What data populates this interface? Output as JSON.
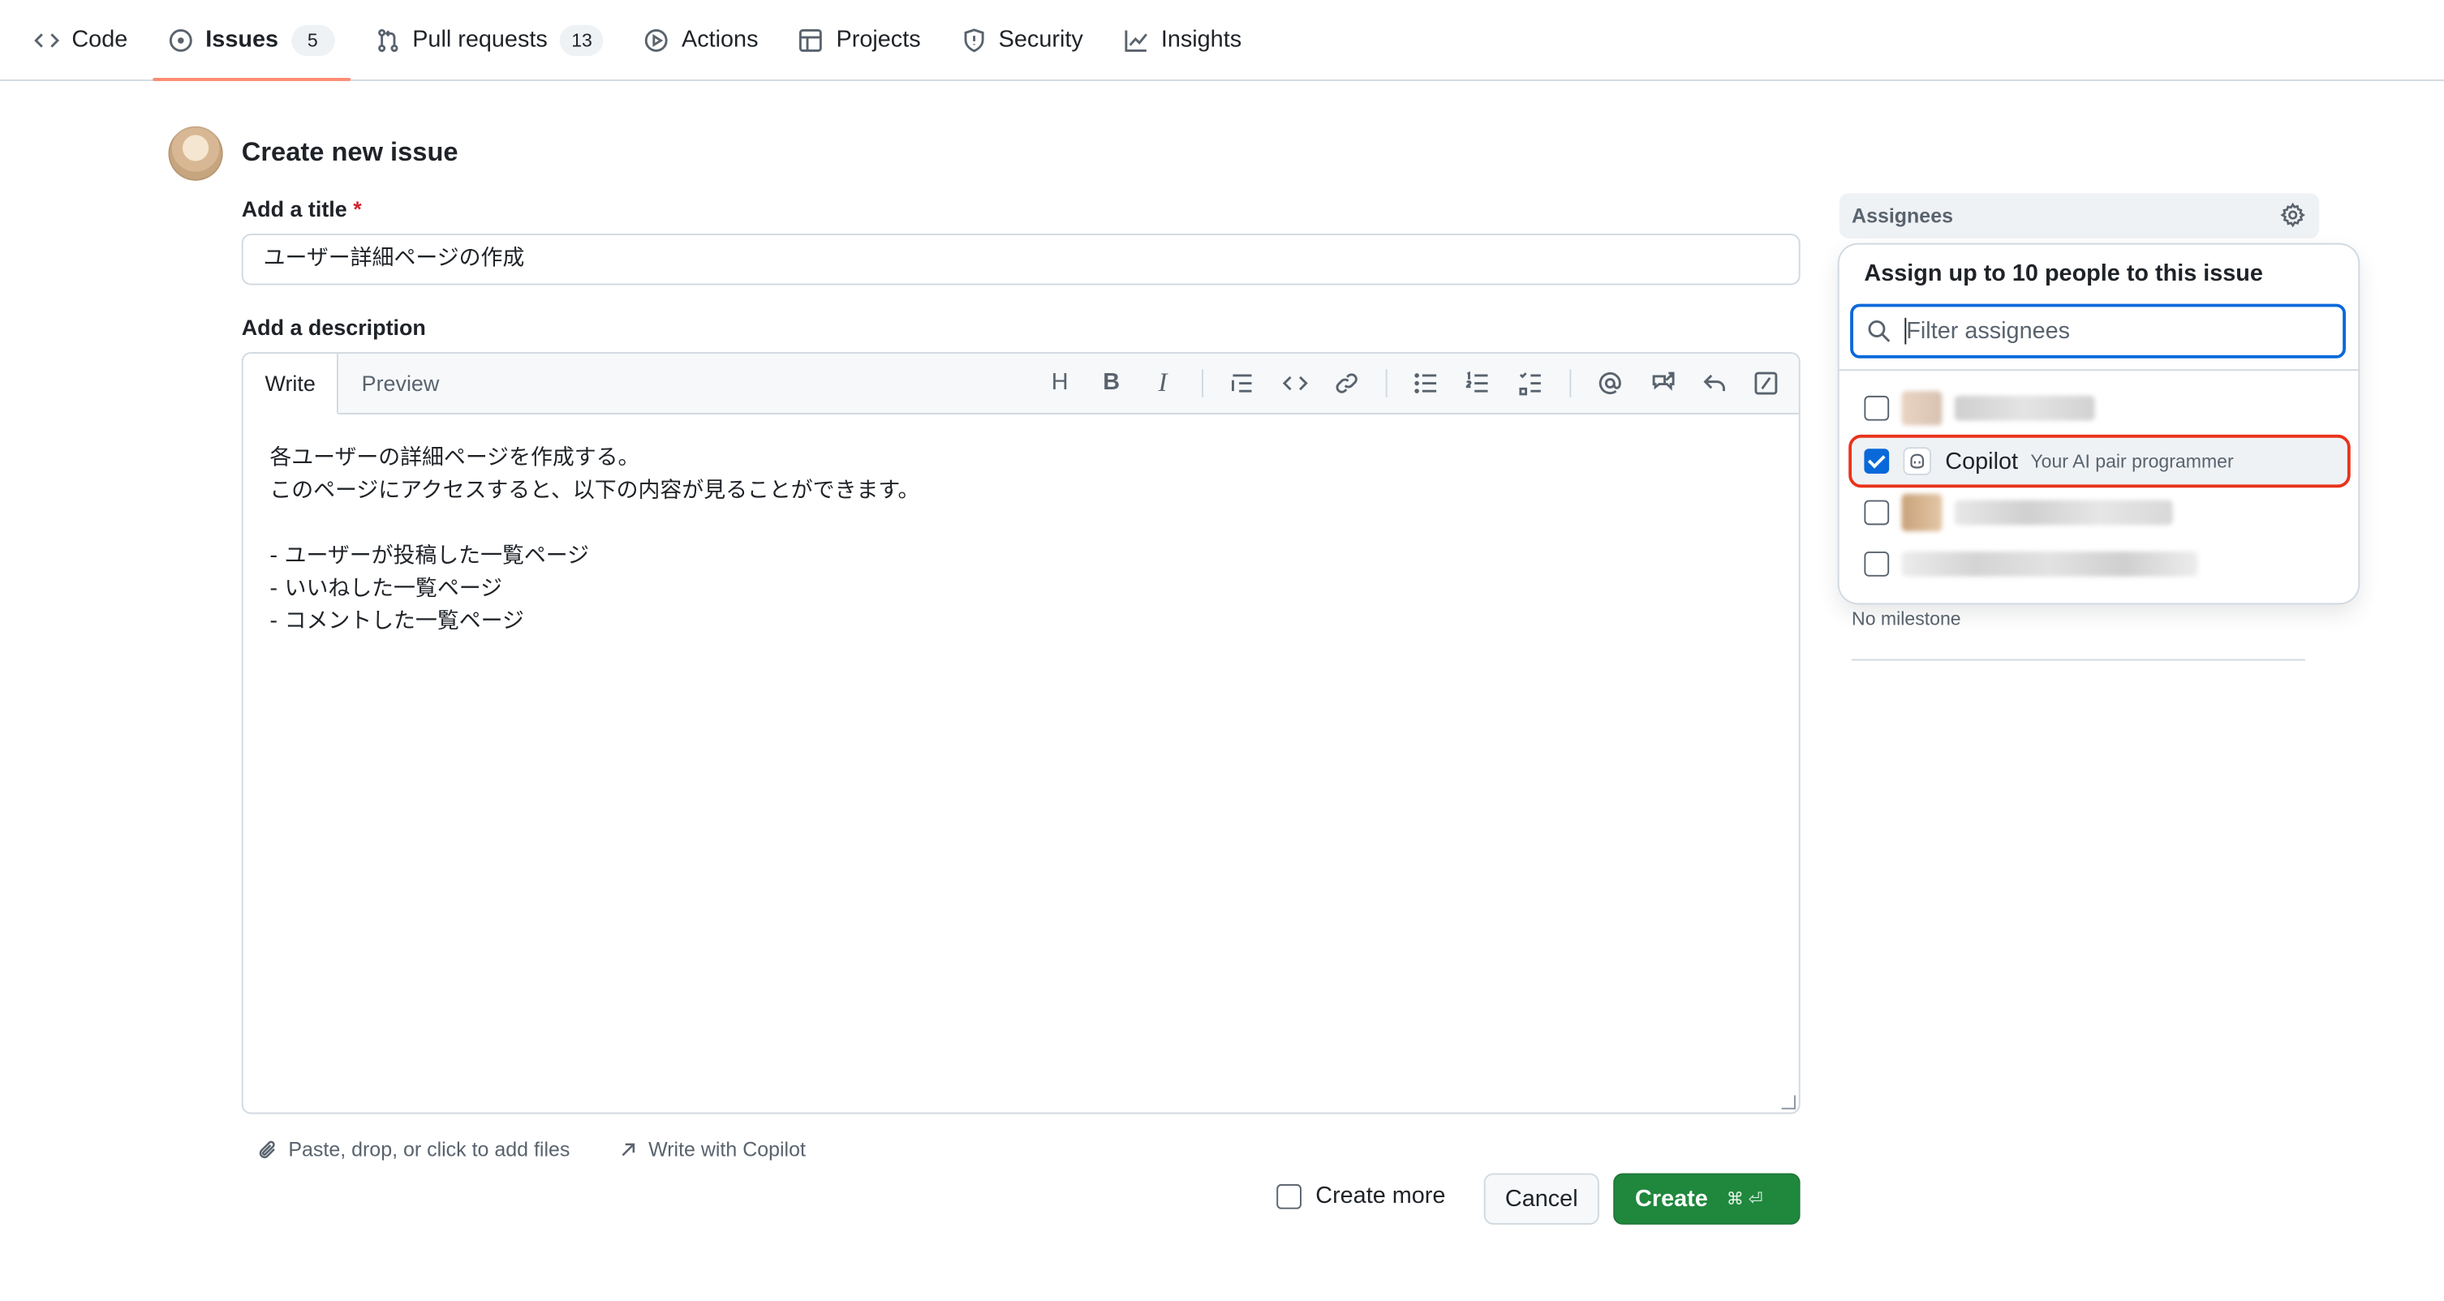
{
  "nav": {
    "tabs": [
      {
        "label": "Code",
        "icon": "code-icon"
      },
      {
        "label": "Issues",
        "icon": "issue-opened-icon",
        "count": "5",
        "active": true
      },
      {
        "label": "Pull requests",
        "icon": "git-pull-request-icon",
        "count": "13"
      },
      {
        "label": "Actions",
        "icon": "play-icon"
      },
      {
        "label": "Projects",
        "icon": "table-icon"
      },
      {
        "label": "Security",
        "icon": "shield-icon"
      },
      {
        "label": "Insights",
        "icon": "graph-icon"
      }
    ]
  },
  "header": {
    "title": "Create new issue"
  },
  "form": {
    "title_label": "Add a title",
    "required_mark": "*",
    "title_value": "ユーザー詳細ページの作成",
    "description_label": "Add a description",
    "tabs": {
      "write": "Write",
      "preview": "Preview"
    },
    "description_value": "各ユーザーの詳細ページを作成する。\nこのページにアクセスすると、以下の内容が見ることができます。\n\n- ユーザーが投稿した一覧ページ\n- いいねした一覧ページ\n- コメントした一覧ページ",
    "attach_hint": "Paste, drop, or click to add files",
    "copilot_link": "Write with Copilot",
    "create_more": "Create more",
    "cancel": "Cancel",
    "create": "Create",
    "create_shortcut": "⌘ ⏎"
  },
  "toolbar": {
    "heading_glyph": "H",
    "bold_glyph": "B",
    "italic_glyph": "I"
  },
  "sidebar": {
    "assignees_label": "Assignees",
    "milestone_value": "No milestone"
  },
  "assignee_dropdown": {
    "title": "Assign up to 10 people to this issue",
    "search_placeholder": "Filter assignees",
    "options": [
      {
        "name": "",
        "checked": false,
        "redacted": true
      },
      {
        "name": "Copilot",
        "description": "Your AI pair programmer",
        "checked": true
      },
      {
        "name": "",
        "checked": false,
        "redacted": true
      },
      {
        "name": "",
        "checked": false,
        "redacted": true
      }
    ]
  },
  "colors": {
    "accent": "#0969da",
    "create_button": "#1f883d",
    "active_tab_underline": "#fd8c73",
    "highlight_outline": "#e8331c"
  }
}
